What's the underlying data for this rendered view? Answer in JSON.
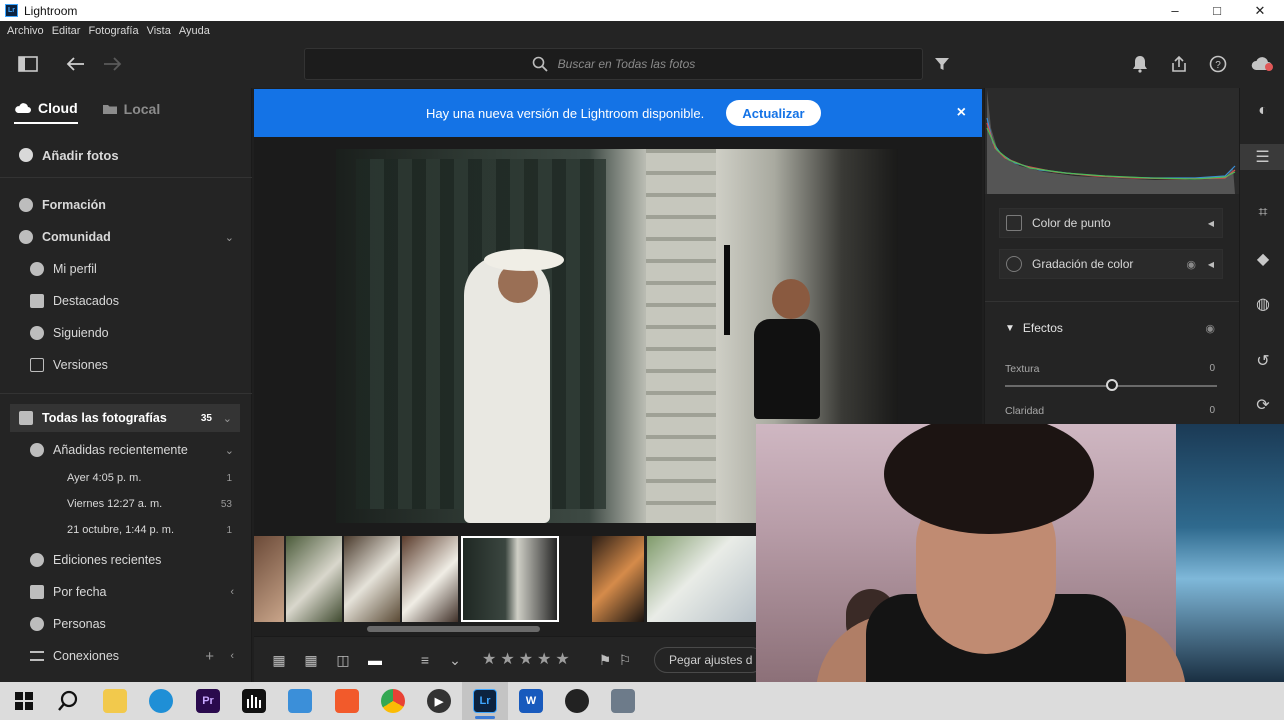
{
  "window": {
    "title": "Lightroom",
    "minimize": "–",
    "maximize": "□",
    "close": "✕"
  },
  "menu": [
    "Archivo",
    "Editar",
    "Fotografía",
    "Vista",
    "Ayuda"
  ],
  "search": {
    "placeholder": "Buscar en Todas las fotos"
  },
  "sidebar": {
    "tabs": [
      {
        "label": "Cloud",
        "active": true
      },
      {
        "label": "Local",
        "active": false
      }
    ],
    "add_photos": "Añadir fotos",
    "learn": "Formación",
    "community": {
      "label": "Comunidad",
      "items": [
        "Mi perfil",
        "Destacados",
        "Siguiendo",
        "Versiones"
      ]
    },
    "all_photos": {
      "label": "Todas las fotografías",
      "count": "35"
    },
    "recently_added": {
      "label": "Añadidas recientemente",
      "items": [
        {
          "label": "Ayer 4:05 p. m.",
          "count": "1"
        },
        {
          "label": "Viernes 12:27 a. m.",
          "count": "53"
        },
        {
          "label": "21 octubre, 1:44 p. m.",
          "count": "1"
        }
      ]
    },
    "recent_edits": "Ediciones recientes",
    "by_date": "Por fecha",
    "people": "Personas",
    "connections": "Conexiones"
  },
  "banner": {
    "message": "Hay una nueva versión de Lightroom disponible.",
    "button": "Actualizar",
    "close": "×"
  },
  "right_panel": {
    "point_color": "Color de punto",
    "color_grading": "Gradación de color",
    "effects": {
      "title": "Efectos",
      "sliders": [
        {
          "label": "Textura",
          "value": "0",
          "level": 0.5
        },
        {
          "label": "Claridad",
          "value": "0",
          "level": 0.5
        }
      ]
    }
  },
  "bottom_bar": {
    "stars": [
      "★",
      "★",
      "★",
      "★",
      "★"
    ],
    "paste_label": "Pegar ajustes d"
  },
  "taskbar": {
    "apps": [
      "windows-start",
      "search",
      "file-explorer",
      "edge",
      "premiere",
      "audio",
      "photos",
      "brave",
      "chrome",
      "media",
      "lightroom",
      "word",
      "obs",
      "camera"
    ]
  },
  "colors": {
    "banner": "#1473e6",
    "app_bg": "#1f1f1f",
    "panel_bg": "#242424"
  }
}
